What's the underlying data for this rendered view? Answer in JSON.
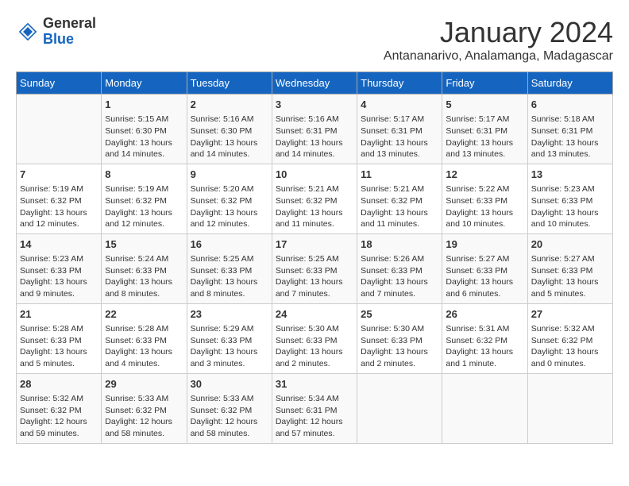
{
  "header": {
    "logo_general": "General",
    "logo_blue": "Blue",
    "month_title": "January 2024",
    "location": "Antananarivo, Analamanga, Madagascar"
  },
  "days_of_week": [
    "Sunday",
    "Monday",
    "Tuesday",
    "Wednesday",
    "Thursday",
    "Friday",
    "Saturday"
  ],
  "weeks": [
    [
      {
        "day": "",
        "content": ""
      },
      {
        "day": "1",
        "content": "Sunrise: 5:15 AM\nSunset: 6:30 PM\nDaylight: 13 hours\nand 14 minutes."
      },
      {
        "day": "2",
        "content": "Sunrise: 5:16 AM\nSunset: 6:30 PM\nDaylight: 13 hours\nand 14 minutes."
      },
      {
        "day": "3",
        "content": "Sunrise: 5:16 AM\nSunset: 6:31 PM\nDaylight: 13 hours\nand 14 minutes."
      },
      {
        "day": "4",
        "content": "Sunrise: 5:17 AM\nSunset: 6:31 PM\nDaylight: 13 hours\nand 13 minutes."
      },
      {
        "day": "5",
        "content": "Sunrise: 5:17 AM\nSunset: 6:31 PM\nDaylight: 13 hours\nand 13 minutes."
      },
      {
        "day": "6",
        "content": "Sunrise: 5:18 AM\nSunset: 6:31 PM\nDaylight: 13 hours\nand 13 minutes."
      }
    ],
    [
      {
        "day": "7",
        "content": "Sunrise: 5:19 AM\nSunset: 6:32 PM\nDaylight: 13 hours\nand 12 minutes."
      },
      {
        "day": "8",
        "content": "Sunrise: 5:19 AM\nSunset: 6:32 PM\nDaylight: 13 hours\nand 12 minutes."
      },
      {
        "day": "9",
        "content": "Sunrise: 5:20 AM\nSunset: 6:32 PM\nDaylight: 13 hours\nand 12 minutes."
      },
      {
        "day": "10",
        "content": "Sunrise: 5:21 AM\nSunset: 6:32 PM\nDaylight: 13 hours\nand 11 minutes."
      },
      {
        "day": "11",
        "content": "Sunrise: 5:21 AM\nSunset: 6:32 PM\nDaylight: 13 hours\nand 11 minutes."
      },
      {
        "day": "12",
        "content": "Sunrise: 5:22 AM\nSunset: 6:33 PM\nDaylight: 13 hours\nand 10 minutes."
      },
      {
        "day": "13",
        "content": "Sunrise: 5:23 AM\nSunset: 6:33 PM\nDaylight: 13 hours\nand 10 minutes."
      }
    ],
    [
      {
        "day": "14",
        "content": "Sunrise: 5:23 AM\nSunset: 6:33 PM\nDaylight: 13 hours\nand 9 minutes."
      },
      {
        "day": "15",
        "content": "Sunrise: 5:24 AM\nSunset: 6:33 PM\nDaylight: 13 hours\nand 8 minutes."
      },
      {
        "day": "16",
        "content": "Sunrise: 5:25 AM\nSunset: 6:33 PM\nDaylight: 13 hours\nand 8 minutes."
      },
      {
        "day": "17",
        "content": "Sunrise: 5:25 AM\nSunset: 6:33 PM\nDaylight: 13 hours\nand 7 minutes."
      },
      {
        "day": "18",
        "content": "Sunrise: 5:26 AM\nSunset: 6:33 PM\nDaylight: 13 hours\nand 7 minutes."
      },
      {
        "day": "19",
        "content": "Sunrise: 5:27 AM\nSunset: 6:33 PM\nDaylight: 13 hours\nand 6 minutes."
      },
      {
        "day": "20",
        "content": "Sunrise: 5:27 AM\nSunset: 6:33 PM\nDaylight: 13 hours\nand 5 minutes."
      }
    ],
    [
      {
        "day": "21",
        "content": "Sunrise: 5:28 AM\nSunset: 6:33 PM\nDaylight: 13 hours\nand 5 minutes."
      },
      {
        "day": "22",
        "content": "Sunrise: 5:28 AM\nSunset: 6:33 PM\nDaylight: 13 hours\nand 4 minutes."
      },
      {
        "day": "23",
        "content": "Sunrise: 5:29 AM\nSunset: 6:33 PM\nDaylight: 13 hours\nand 3 minutes."
      },
      {
        "day": "24",
        "content": "Sunrise: 5:30 AM\nSunset: 6:33 PM\nDaylight: 13 hours\nand 2 minutes."
      },
      {
        "day": "25",
        "content": "Sunrise: 5:30 AM\nSunset: 6:33 PM\nDaylight: 13 hours\nand 2 minutes."
      },
      {
        "day": "26",
        "content": "Sunrise: 5:31 AM\nSunset: 6:32 PM\nDaylight: 13 hours\nand 1 minute."
      },
      {
        "day": "27",
        "content": "Sunrise: 5:32 AM\nSunset: 6:32 PM\nDaylight: 13 hours\nand 0 minutes."
      }
    ],
    [
      {
        "day": "28",
        "content": "Sunrise: 5:32 AM\nSunset: 6:32 PM\nDaylight: 12 hours\nand 59 minutes."
      },
      {
        "day": "29",
        "content": "Sunrise: 5:33 AM\nSunset: 6:32 PM\nDaylight: 12 hours\nand 58 minutes."
      },
      {
        "day": "30",
        "content": "Sunrise: 5:33 AM\nSunset: 6:32 PM\nDaylight: 12 hours\nand 58 minutes."
      },
      {
        "day": "31",
        "content": "Sunrise: 5:34 AM\nSunset: 6:31 PM\nDaylight: 12 hours\nand 57 minutes."
      },
      {
        "day": "",
        "content": ""
      },
      {
        "day": "",
        "content": ""
      },
      {
        "day": "",
        "content": ""
      }
    ]
  ]
}
